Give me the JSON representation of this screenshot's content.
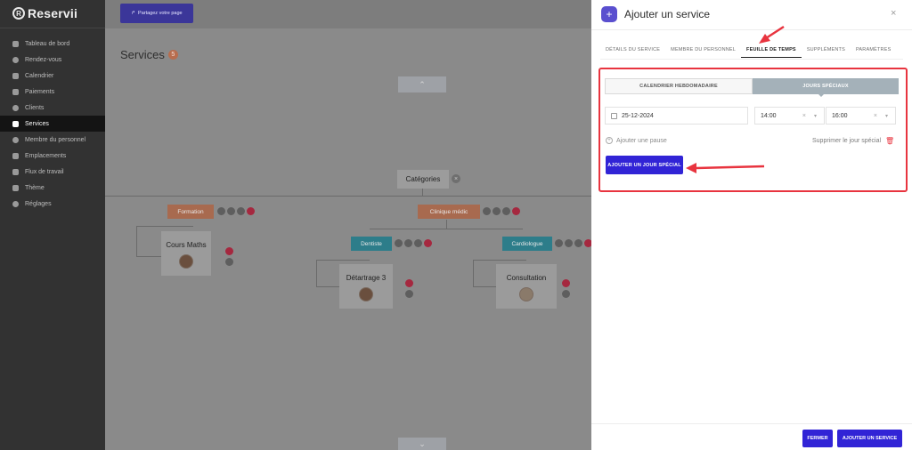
{
  "app": {
    "name": "Reservii",
    "logo_mark": "R"
  },
  "sidebar": {
    "items": [
      {
        "label": "Tableau de bord",
        "icon": "dashboard-icon",
        "active": false
      },
      {
        "label": "Rendez-vous",
        "icon": "clock-icon",
        "active": false
      },
      {
        "label": "Calendrier",
        "icon": "calendar-icon",
        "active": false
      },
      {
        "label": "Paiements",
        "icon": "wallet-icon",
        "active": false
      },
      {
        "label": "Clients",
        "icon": "users-icon",
        "active": false
      },
      {
        "label": "Services",
        "icon": "services-icon",
        "active": true
      },
      {
        "label": "Membre du personnel",
        "icon": "person-icon",
        "active": false
      },
      {
        "label": "Emplacements",
        "icon": "location-icon",
        "active": false
      },
      {
        "label": "Flux de travail",
        "icon": "workflow-icon",
        "active": false
      },
      {
        "label": "Thème",
        "icon": "brush-icon",
        "active": false
      },
      {
        "label": "Réglages",
        "icon": "gear-icon",
        "active": false
      }
    ]
  },
  "topbar": {
    "share_label": "Partagez votre page"
  },
  "main": {
    "title": "Services",
    "count": "5",
    "collapse_up": "⌃",
    "collapse_down": "⌄",
    "categories_label": "Catégories",
    "categories": [
      {
        "label": "Formation",
        "color": "orange"
      },
      {
        "label": "Clinique médic",
        "color": "orange"
      },
      {
        "label": "Dentiste",
        "color": "teal"
      },
      {
        "label": "Cardiologue",
        "color": "teal"
      }
    ],
    "services": [
      {
        "title": "Cours Maths"
      },
      {
        "title": "Détartrage 3"
      },
      {
        "title": "Consultation"
      }
    ]
  },
  "modal": {
    "title": "Ajouter un service",
    "plus": "+",
    "close": "×",
    "tabs": [
      {
        "label": "DÉTAILS DU SERVICE",
        "active": false
      },
      {
        "label": "MEMBRE DU PERSONNEL",
        "active": false
      },
      {
        "label": "FEUILLE DE TEMPS",
        "active": true
      },
      {
        "label": "SUPPLÉMENTS",
        "active": false
      },
      {
        "label": "PARAMÈTRES",
        "active": false
      }
    ],
    "segments": {
      "weekly": "CALENDRIER HEBDOMADAIRE",
      "special": "JOURS SPÉCIAUX"
    },
    "date_value": "25-12-2024",
    "start_time": "14:00",
    "end_time": "16:00",
    "add_pause": "Ajouter une pause",
    "delete_day": "Supprimer le jour spécial",
    "add_day_button": "AJOUTER UN JOUR SPÉCIAL",
    "footer": {
      "close": "FERMER",
      "add": "AJOUTER UN SERVICE"
    }
  },
  "colors": {
    "accent": "#3124d6",
    "highlight": "#e8343f",
    "sidebar": "#323232"
  }
}
